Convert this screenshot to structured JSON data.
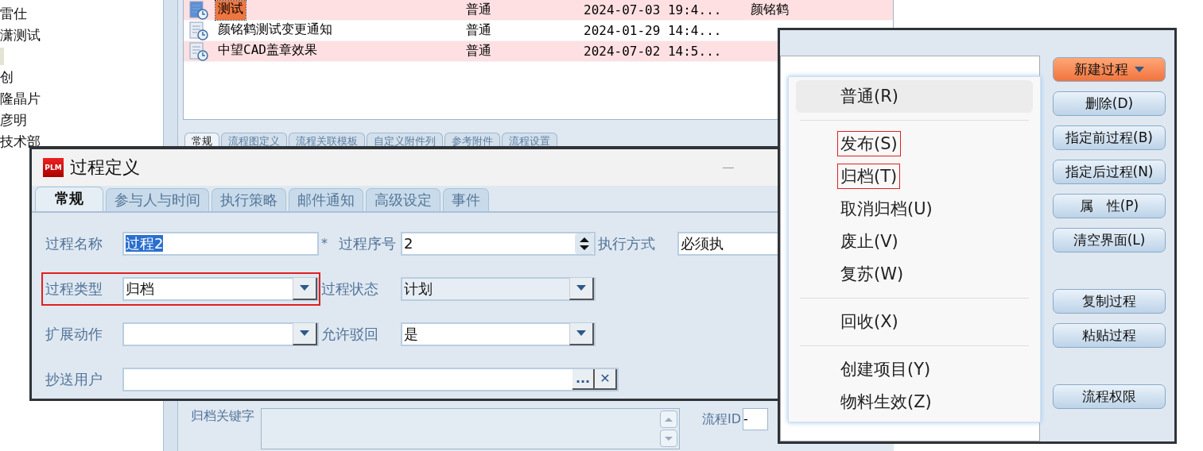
{
  "tree": {
    "items": [
      {
        "label": "雷仕"
      },
      {
        "label": "潇测试"
      },
      {
        "kind": "swatch"
      },
      {
        "label": "创"
      },
      {
        "label": "隆晶片"
      },
      {
        "label": "彦明"
      },
      {
        "label": "技术部"
      }
    ]
  },
  "process_list": {
    "rows": [
      {
        "name": "测试",
        "type": "普通",
        "time": "2024-07-03 19:4...",
        "author": "颜铭鹤",
        "selected": true,
        "highlighted": true
      },
      {
        "name": "颜铭鹤测试变更通知",
        "type": "普通",
        "time": "2024-01-29 14:4...",
        "selected": false,
        "highlighted": false
      },
      {
        "name": "中望CAD盖章效果",
        "type": "普通",
        "time": "2024-07-02 14:5...",
        "selected": false,
        "highlighted": true
      }
    ]
  },
  "detail_tabs": [
    {
      "label": "常规",
      "selected": true
    },
    {
      "label": "流程图定义",
      "selected": false
    },
    {
      "label": "流程关联模板",
      "selected": false
    },
    {
      "label": "自定义附件列",
      "selected": false
    },
    {
      "label": "参考附件",
      "selected": false
    },
    {
      "label": "流程设置",
      "selected": false
    }
  ],
  "detail": {
    "archive_keyword_label": "归档关键字",
    "flow_id_label": "流程ID",
    "flow_id_value": "-"
  },
  "dialog": {
    "logo": "PLM",
    "title": "过程定义",
    "tabs": [
      {
        "label": "常规",
        "selected": true
      },
      {
        "label": "参与人与时间",
        "selected": false
      },
      {
        "label": "执行策略",
        "selected": false
      },
      {
        "label": "邮件通知",
        "selected": false
      },
      {
        "label": "高级设定",
        "selected": false
      },
      {
        "label": "事件",
        "selected": false
      }
    ],
    "rows": [
      [
        {
          "label": "过程名称",
          "value": "过程2",
          "kind": "text",
          "value_selected": true,
          "annotated": false
        },
        {
          "label": "过程序号",
          "value": "2",
          "kind": "spinner",
          "required_mark": "*",
          "annotated": false
        },
        {
          "label": "执行方式",
          "value": "必须执",
          "kind": "text",
          "annotated": false
        }
      ],
      [
        {
          "label": "过程类型",
          "value": "归档",
          "kind": "dropdown",
          "annotated": true
        },
        {
          "label": "过程状态",
          "value": "计划",
          "kind": "dropdown",
          "disabled": true,
          "annotated": false
        }
      ],
      [
        {
          "label": "扩展动作",
          "kind": "dropdown",
          "annotated": false
        },
        {
          "label": "允许驳回",
          "value": "是",
          "kind": "dropdown",
          "annotated": false
        }
      ],
      [
        {
          "label": "抄送用户",
          "kind": "lookup",
          "lookup_button": "...",
          "clear_button": "✕",
          "annotated": false
        }
      ]
    ]
  },
  "side_panel": {
    "buttons": [
      {
        "label": "新建过程",
        "primary": true,
        "has_menu": true,
        "group_gap": false
      },
      {
        "label": "删除(D)",
        "primary": false,
        "has_menu": false,
        "group_gap": false
      },
      {
        "label": "指定前过程(B)",
        "primary": false,
        "has_menu": false,
        "group_gap": false
      },
      {
        "label": "指定后过程(N)",
        "primary": false,
        "has_menu": false,
        "group_gap": false
      },
      {
        "label": "属　性(P)",
        "primary": false,
        "has_menu": false,
        "group_gap": false
      },
      {
        "label": "清空界面(L)",
        "primary": false,
        "has_menu": false,
        "group_gap": false
      },
      {
        "label": "复制过程",
        "primary": false,
        "has_menu": false,
        "group_gap": true
      },
      {
        "label": "粘贴过程",
        "primary": false,
        "has_menu": false,
        "group_gap": false
      },
      {
        "label": "流程权限",
        "primary": false,
        "has_menu": false,
        "group_gap": true
      }
    ],
    "menu": {
      "items": [
        {
          "kind": "item",
          "label": "普通(R)",
          "highlighted": true,
          "annotated": false
        },
        {
          "kind": "separator"
        },
        {
          "kind": "item",
          "label": "发布(S)",
          "highlighted": false,
          "annotated": true
        },
        {
          "kind": "item",
          "label": "归档(T)",
          "highlighted": false,
          "annotated": true
        },
        {
          "kind": "item",
          "label": "取消归档(U)",
          "highlighted": false,
          "annotated": false
        },
        {
          "kind": "item",
          "label": "废止(V)",
          "highlighted": false,
          "annotated": false
        },
        {
          "kind": "item",
          "label": "复苏(W)",
          "highlighted": false,
          "annotated": false
        },
        {
          "kind": "separator"
        },
        {
          "kind": "item",
          "label": "回收(X)",
          "highlighted": false,
          "annotated": false
        },
        {
          "kind": "separator"
        },
        {
          "kind": "item",
          "label": "创建项目(Y)",
          "highlighted": false,
          "annotated": false
        },
        {
          "kind": "item",
          "label": "物料生效(Z)",
          "highlighted": false,
          "annotated": false
        }
      ]
    }
  }
}
